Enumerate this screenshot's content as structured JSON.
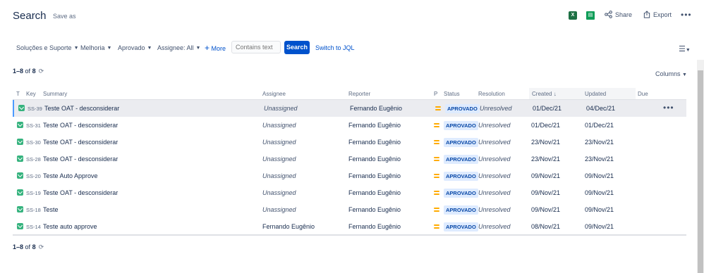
{
  "header": {
    "title": "Search",
    "save_as": "Save as",
    "excel_icon_label": "X",
    "sheets_icon_label": "▤",
    "share_label": "Share",
    "export_label": "Export",
    "more_label": "•••"
  },
  "filters": {
    "items": [
      "Soluções e Suporte",
      "Melhoria",
      "Aprovado",
      "Assignee: All"
    ],
    "more_label": "More",
    "contains_placeholder": "Contains text",
    "search_label": "Search",
    "switch_jql_label": "Switch to JQL"
  },
  "count": {
    "range": "1–8",
    "of": "of",
    "total": "8"
  },
  "columns_label": "Columns",
  "table": {
    "headers": {
      "type": "T",
      "key": "Key",
      "summary": "Summary",
      "assignee": "Assignee",
      "reporter": "Reporter",
      "priority": "P",
      "status": "Status",
      "resolution": "Resolution",
      "created": "Created",
      "updated": "Updated",
      "due": "Due"
    },
    "rows": [
      {
        "key": "SS-39",
        "summary": "Teste OAT - desconsiderar",
        "assignee": "Unassigned",
        "reporter": "Fernando Eugênio",
        "status": "APROVADO",
        "resolution": "Unresolved",
        "created": "01/Dec/21",
        "updated": "04/Dec/21"
      },
      {
        "key": "SS-31",
        "summary": "Teste OAT - desconsiderar",
        "assignee": "Unassigned",
        "reporter": "Fernando Eugênio",
        "status": "APROVADO",
        "resolution": "Unresolved",
        "created": "01/Dec/21",
        "updated": "01/Dec/21"
      },
      {
        "key": "SS-30",
        "summary": "Teste OAT - desconsiderar",
        "assignee": "Unassigned",
        "reporter": "Fernando Eugênio",
        "status": "APROVADO",
        "resolution": "Unresolved",
        "created": "23/Nov/21",
        "updated": "23/Nov/21"
      },
      {
        "key": "SS-28",
        "summary": "Teste OAT - desconsiderar",
        "assignee": "Unassigned",
        "reporter": "Fernando Eugênio",
        "status": "APROVADO",
        "resolution": "Unresolved",
        "created": "23/Nov/21",
        "updated": "23/Nov/21"
      },
      {
        "key": "SS-20",
        "summary": "Teste Auto Approve",
        "assignee": "Unassigned",
        "reporter": "Fernando Eugênio",
        "status": "APROVADO",
        "resolution": "Unresolved",
        "created": "09/Nov/21",
        "updated": "09/Nov/21"
      },
      {
        "key": "SS-19",
        "summary": "Teste OAT - desconsiderar",
        "assignee": "Unassigned",
        "reporter": "Fernando Eugênio",
        "status": "APROVADO",
        "resolution": "Unresolved",
        "created": "09/Nov/21",
        "updated": "09/Nov/21"
      },
      {
        "key": "SS-18",
        "summary": "Teste",
        "assignee": "Unassigned",
        "reporter": "Fernando Eugênio",
        "status": "APROVADO",
        "resolution": "Unresolved",
        "created": "09/Nov/21",
        "updated": "09/Nov/21"
      },
      {
        "key": "SS-14",
        "summary": "Teste auto approve",
        "assignee": "Fernando Eugênio",
        "reporter": "Fernando Eugênio",
        "status": "APROVADO",
        "resolution": "Unresolved",
        "created": "08/Nov/21",
        "updated": "09/Nov/21"
      }
    ],
    "row_actions_label": "•••"
  },
  "colors": {
    "accent": "#0052cc",
    "story": "#36b37e",
    "priority_medium": "#ffab00",
    "status_bg": "#deebff",
    "status_text": "#0747a6"
  },
  "icons": {
    "share": "share-icon",
    "export": "export-icon",
    "refresh": "refresh-icon",
    "menu": "list-view-icon",
    "sort": "arrow-down-icon"
  }
}
